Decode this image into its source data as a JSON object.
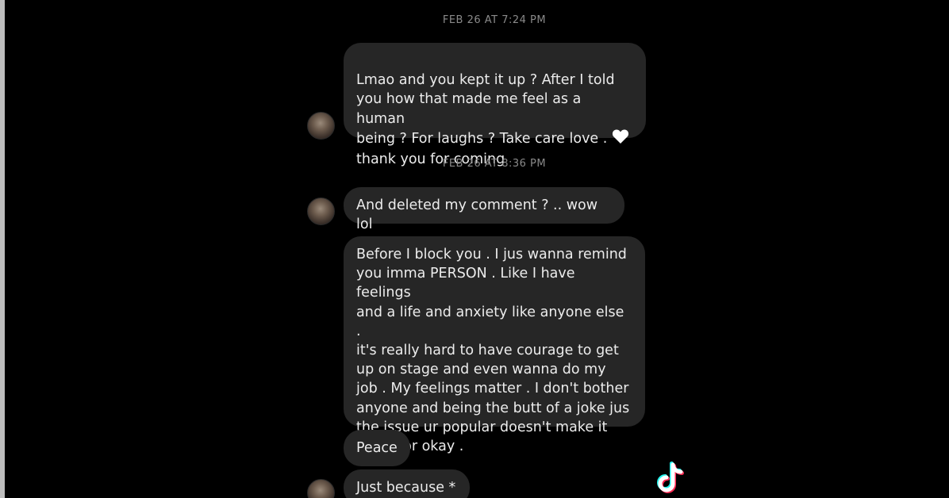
{
  "conversation": {
    "timestamp_1": "FEB 26 AT 7:24 PM",
    "timestamp_2": "FEB 26 AT 8:36 PM",
    "messages": [
      {
        "text": "Lmao and you kept it up ? After I told\nyou how that made me feel as a human\nbeing ? For laughs ? Take care love .",
        "emoji": "white-heart-icon"
      },
      {
        "text": "thank you for coming"
      },
      {
        "text": "And deleted my comment ? .. wow lol"
      },
      {
        "text": "Before I block you . I jus wanna remind\nyou imma PERSON . Like I have feelings\nand a life and anxiety like anyone else .\nit's really hard to have courage to get\nup on stage and even wanna do my\njob . My feelings matter . I don't bother\nanyone and being the butt of a joke jus\nthe issue ur popular doesn't make it\nbetter or okay ."
      },
      {
        "text": "Peace"
      },
      {
        "text": "Just because *"
      }
    ]
  },
  "watermark": {
    "icon": "tiktok-logo-icon"
  },
  "colors": {
    "background": "#000000",
    "bubble": "#262626",
    "text": "#ececec",
    "timestamp": "#8a8a8a"
  }
}
